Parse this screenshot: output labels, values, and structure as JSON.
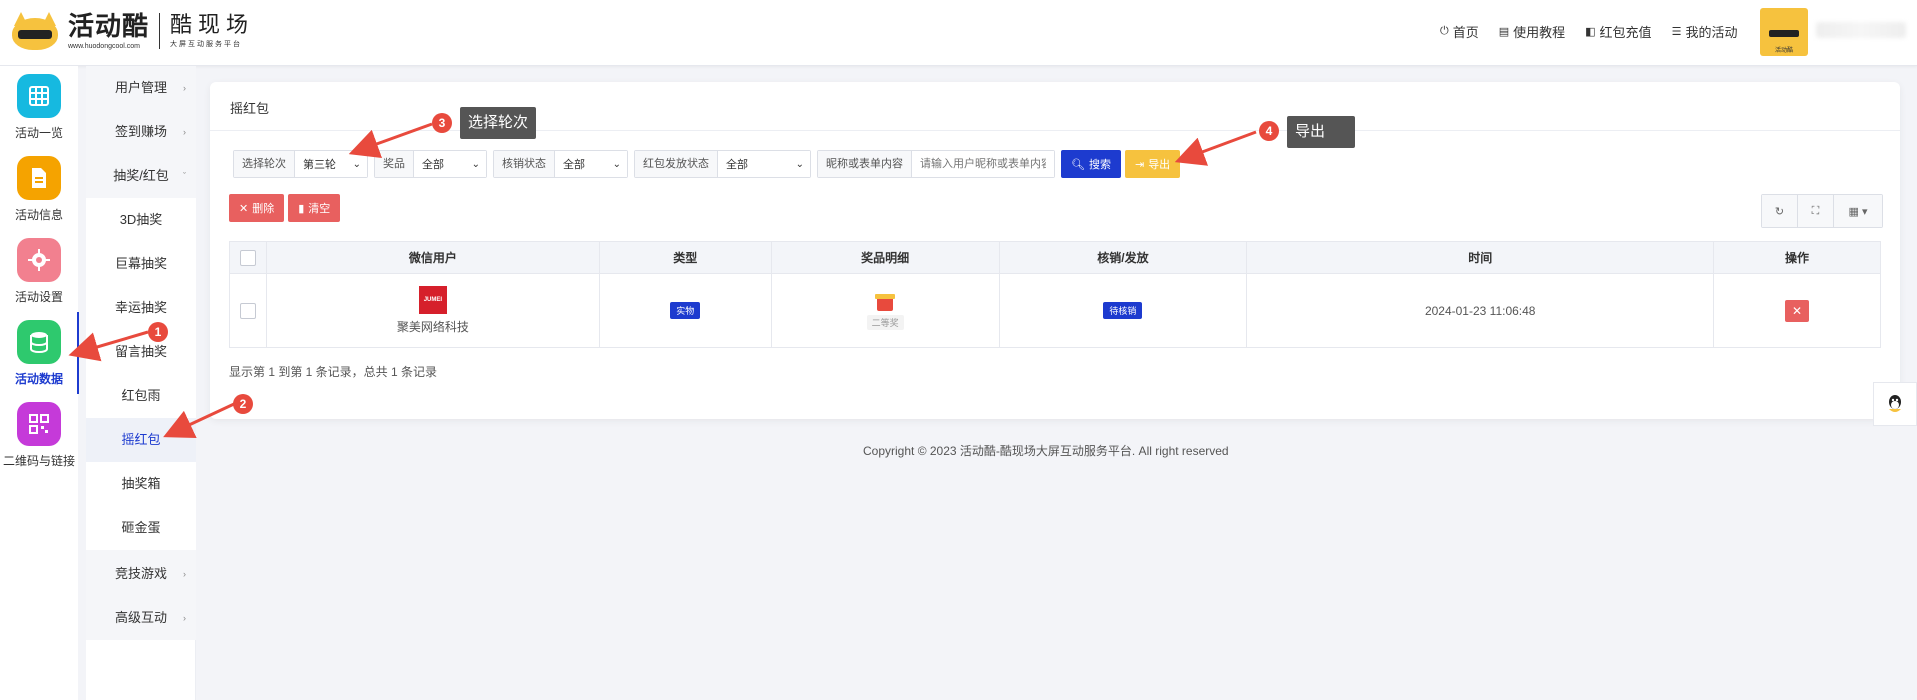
{
  "logo": {
    "title": "活动酷",
    "url": "www.huodongcool.com",
    "sub_title": "酷现场",
    "sub_tag": "大屏互动服务平台"
  },
  "topnav": [
    {
      "icon": "home-icon",
      "glyph": "⏻",
      "label": "首页"
    },
    {
      "icon": "book-icon",
      "glyph": "▤",
      "label": "使用教程"
    },
    {
      "icon": "wallet-icon",
      "glyph": "◧",
      "label": "红包充值"
    },
    {
      "icon": "list-icon",
      "glyph": "☰",
      "label": "我的活动"
    }
  ],
  "avatar_tag": "活动酷",
  "iconbar": [
    {
      "label": "活动一览",
      "color": "#16b9e0",
      "icon": "grid-icon",
      "glyph": "▦"
    },
    {
      "label": "活动信息",
      "color": "#f5a300",
      "icon": "document-icon",
      "glyph": "▤"
    },
    {
      "label": "活动设置",
      "color": "#f2808f",
      "icon": "gear-icon",
      "glyph": "✿"
    },
    {
      "label": "活动数据",
      "color": "#2ec96e",
      "icon": "database-icon",
      "glyph": "☰"
    },
    {
      "label": "二维码与链接",
      "color": "#c53ad9",
      "icon": "qrcode-icon",
      "glyph": "▣"
    }
  ],
  "submenu": {
    "groups": [
      "用户管理",
      "签到赚场",
      "抽奖/红包",
      "竞技游戏",
      "高级互动"
    ],
    "items": [
      "3D抽奖",
      "巨幕抽奖",
      "幸运抽奖",
      "留言抽奖",
      "红包雨",
      "摇红包",
      "抽奖箱",
      "砸金蛋"
    ]
  },
  "panel": {
    "title": "摇红包"
  },
  "filters": {
    "round_label": "选择轮次",
    "round_value": "第三轮",
    "prize_label": "奖品",
    "prize_value": "全部",
    "verify_label": "核销状态",
    "verify_value": "全部",
    "issue_label": "红包发放状态",
    "issue_value": "全部",
    "keyword_label": "昵称或表单内容",
    "keyword_placeholder": "请输入用户昵称或表单内容",
    "search_label": "搜索",
    "export_label": "导出"
  },
  "actions": {
    "delete_label": "删除",
    "clear_label": "清空"
  },
  "table": {
    "headers": [
      "微信用户",
      "类型",
      "奖品明细",
      "核销/发放",
      "时间",
      "操作"
    ],
    "rows": [
      {
        "avatar_text": "JUMEI",
        "user": "聚美网络科技",
        "type": "实物",
        "prize_tag": "二等奖",
        "status": "待核销",
        "time": "2024-01-23 11:06:48"
      }
    ]
  },
  "pageinfo": "显示第 1 到第 1 条记录，总共 1 条记录",
  "copyright": "Copyright © 2023 活动酷-酷现场大屏互动服务平台. All right reserved",
  "annotations": {
    "n1": "1",
    "n2": "2",
    "n3": "3",
    "n4": "4",
    "tip3": "选择轮次",
    "tip4": "导出"
  },
  "colors": {
    "primary": "#1d3bcf",
    "export": "#f6c23e",
    "danger": "#e8605f",
    "annotation": "#e84a3d"
  }
}
